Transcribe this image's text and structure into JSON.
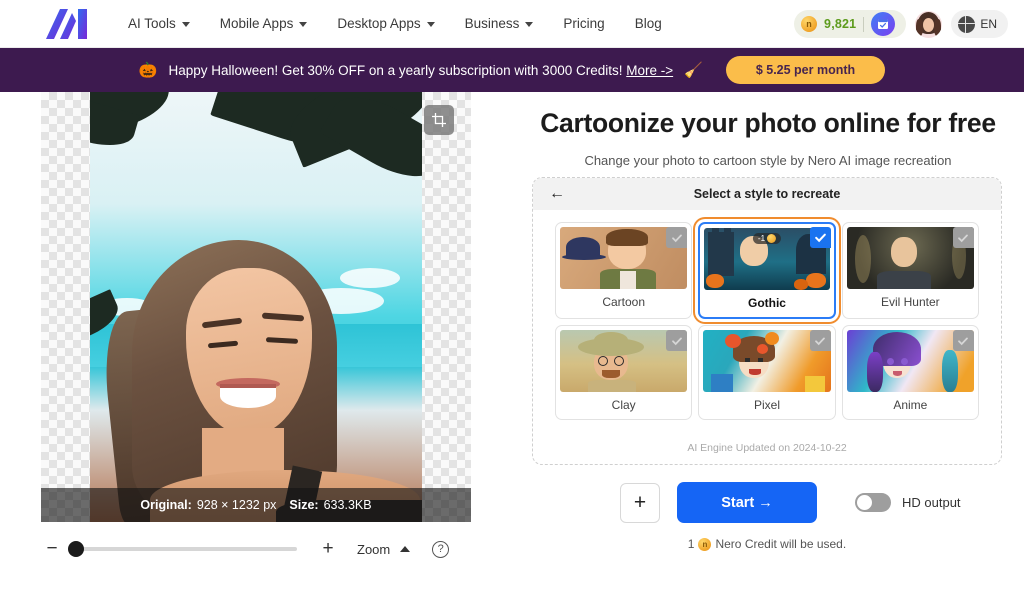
{
  "header": {
    "logo_alt": "Nero AI logo",
    "nav": [
      {
        "label": "AI Tools",
        "has_dropdown": true
      },
      {
        "label": "Mobile Apps",
        "has_dropdown": true
      },
      {
        "label": "Desktop Apps",
        "has_dropdown": true
      },
      {
        "label": "Business",
        "has_dropdown": true
      },
      {
        "label": "Pricing",
        "has_dropdown": false
      },
      {
        "label": "Blog",
        "has_dropdown": false
      }
    ],
    "credits": "9,821",
    "coin_glyph": "n",
    "language": "EN"
  },
  "banner": {
    "pumpkin": "🎃",
    "text_before": "Happy Halloween! Get 30% OFF on a yearly subscription with 3000 Credits! ",
    "link": "More ->",
    "broom": "🧹",
    "button": "$ 5.25 per month",
    "bg_color": "#3d1a4f",
    "button_color": "#fbbd4a"
  },
  "editor": {
    "info_original_label": "Original:",
    "info_dimensions": "928 × 1232 px",
    "info_size_label": "Size:",
    "info_size": "633.3KB",
    "crop_icon": "crop-icon",
    "zoom_label": "Zoom",
    "zoom_minus": "−",
    "zoom_plus": "+",
    "help_icon": "?"
  },
  "main": {
    "title": "Cartoonize your photo online for free",
    "subtitle": "Change your photo to cartoon style by Nero AI image recreation"
  },
  "style_panel": {
    "back_arrow": "←",
    "header_title": "Select a style to recreate",
    "engine_note": "AI Engine Updated on 2024-10-22",
    "selected_index": 1,
    "cards": [
      {
        "label": "Cartoon",
        "selected": false
      },
      {
        "label": "Gothic",
        "selected": true,
        "credit_badge": "-1"
      },
      {
        "label": "Evil Hunter",
        "selected": false
      },
      {
        "label": "Clay",
        "selected": false
      },
      {
        "label": "Pixel",
        "selected": false
      },
      {
        "label": "Anime",
        "selected": false
      }
    ]
  },
  "actions": {
    "add_label": "+",
    "start_label": "Start →",
    "hd_toggle_label": "HD output",
    "hd_toggle_on": false,
    "credit_note_prefix": "1",
    "credit_note_text": "Nero Credit will be used.",
    "accent_color": "#1565f5"
  }
}
